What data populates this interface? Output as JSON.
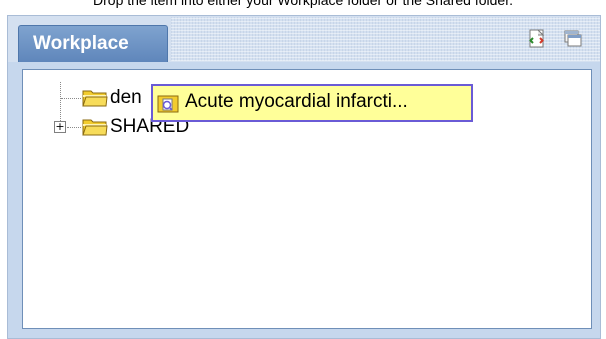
{
  "instruction": "Drop the item into either your Workplace folder or the Shared folder.",
  "panel": {
    "tab_label": "Workplace",
    "toolbar": {
      "refresh_icon": "refresh-icon",
      "window_icon": "window-icon"
    }
  },
  "tree": {
    "nodes": [
      {
        "label": "den",
        "icon": "folder-icon",
        "expandable": false
      },
      {
        "label": "SHARED",
        "icon": "folder-icon",
        "expandable": true,
        "expander_symbol": "+"
      }
    ]
  },
  "drag_ghost": {
    "label": "Acute myocardial infarcti...",
    "icon": "report-icon"
  },
  "colors": {
    "tab": "#6b8fc4",
    "panel": "#c6d7ed",
    "drag_ghost_bg": "#ffff99",
    "drag_ghost_border": "#6a5bd6",
    "folder": "#f2cc2f"
  }
}
